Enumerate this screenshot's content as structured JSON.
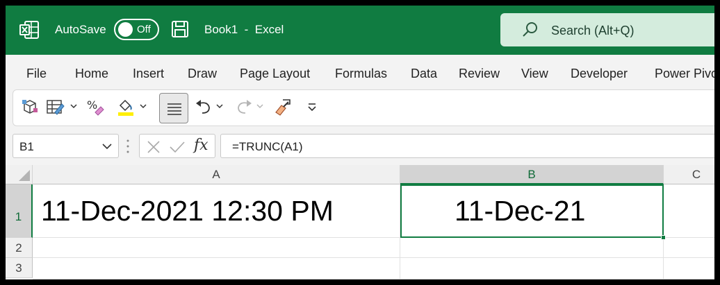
{
  "titlebar": {
    "autosave_label": "AutoSave",
    "autosave_state": "Off",
    "document_title": "Book1  -  Excel",
    "search_placeholder": "Search (Alt+Q)",
    "app_icon": "excel-icon",
    "save_icon": "save-icon",
    "brand_color": "#107c41"
  },
  "menu": {
    "items": [
      "File",
      "Home",
      "Insert",
      "Draw",
      "Page Layout",
      "Formulas",
      "Data",
      "Review",
      "View",
      "Developer",
      "Power Pivot"
    ]
  },
  "ribbon": {
    "buttons": [
      "3d-map-icon",
      "format-table-icon",
      "percent-style-icon",
      "fill-color-icon",
      "align-center-icon",
      "undo-icon",
      "redo-icon",
      "format-painter-icon",
      "customize-qat-icon"
    ]
  },
  "formula_bar": {
    "name_box": "B1",
    "formula": "=TRUNC(A1)",
    "fx_label": "fx"
  },
  "grid": {
    "columns": [
      "A",
      "B",
      "C"
    ],
    "selected_column": "B",
    "rows": [
      "1",
      "2",
      "3"
    ],
    "selected_row": "1",
    "cells": {
      "A1": "11-Dec-2021 12:30  PM",
      "B1": "11-Dec-21"
    }
  }
}
